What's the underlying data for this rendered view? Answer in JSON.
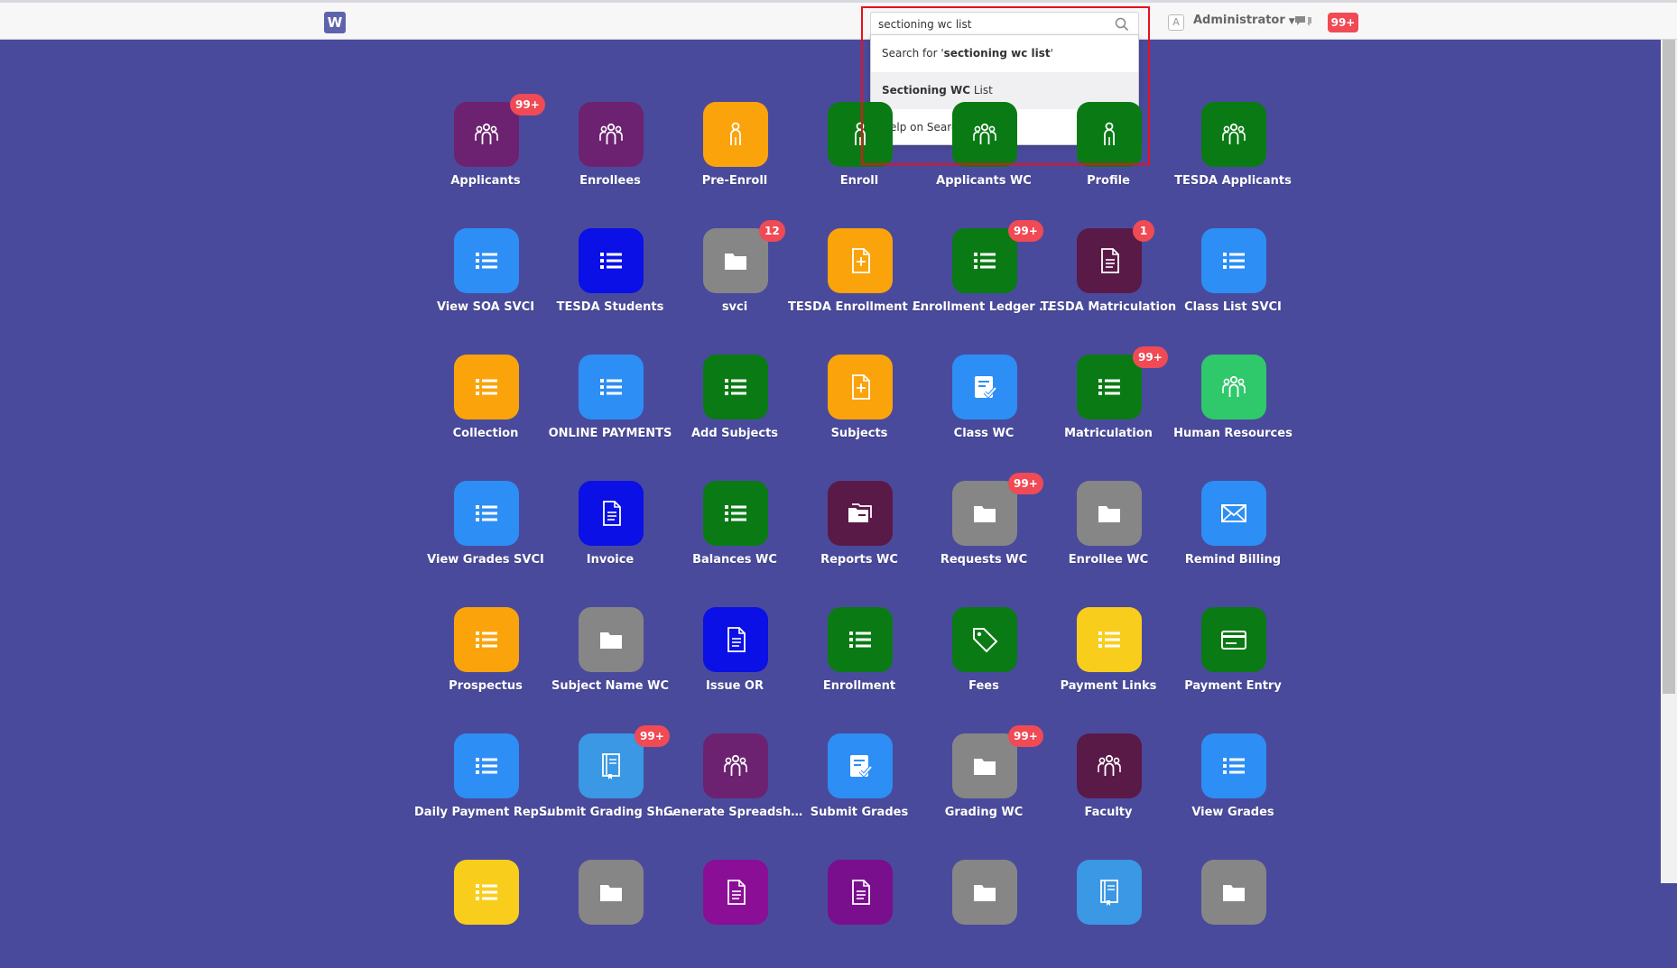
{
  "header": {
    "logo_text": "W",
    "search": {
      "value": "sectioning wc list"
    },
    "user_initial": "A",
    "user_name": "Administrator",
    "notification_count": "99+"
  },
  "dropdown": {
    "items": [
      {
        "prefix": "Search for '",
        "bold": "sectioning wc list",
        "suffix": "'"
      },
      {
        "prefix": "",
        "bold": "Sectioning WC",
        "suffix": " List"
      },
      {
        "prefix": "Help on Search",
        "bold": "",
        "suffix": ""
      }
    ]
  },
  "colors": {
    "background": "#4a4a9c",
    "highlight": "#e8101c",
    "badge": "#f04a55"
  },
  "tiles": [
    {
      "label": "Applicants",
      "color": "#6c2270",
      "icon": "group-icon",
      "badge": "99+"
    },
    {
      "label": "Enrollees",
      "color": "#6c2270",
      "icon": "group-icon",
      "badge": ""
    },
    {
      "label": "Pre-Enroll",
      "color": "#fba30b",
      "icon": "person-icon",
      "badge": ""
    },
    {
      "label": "Enroll",
      "color": "#0a7a14",
      "icon": "person-icon",
      "badge": ""
    },
    {
      "label": "Applicants WC",
      "color": "#0a7a14",
      "icon": "group-icon",
      "badge": ""
    },
    {
      "label": "Profile",
      "color": "#0a7a14",
      "icon": "person-icon",
      "badge": ""
    },
    {
      "label": "TESDA Applicants",
      "color": "#0a7a14",
      "icon": "group-icon",
      "badge": ""
    },
    {
      "label": "View SOA SVCI",
      "color": "#2d8ef5",
      "icon": "list-icon",
      "badge": ""
    },
    {
      "label": "TESDA Students",
      "color": "#0a10e6",
      "icon": "list-icon",
      "badge": ""
    },
    {
      "label": "svci",
      "color": "#868686",
      "icon": "folder-icon",
      "badge": "12"
    },
    {
      "label": "TESDA Enrollment Le...",
      "color": "#fba30b",
      "icon": "file-add-icon",
      "badge": ""
    },
    {
      "label": "Enrollment Ledger WC",
      "color": "#0a7a14",
      "icon": "list-icon",
      "badge": "99+"
    },
    {
      "label": "TESDA Matriculation",
      "color": "#5a1a47",
      "icon": "document-icon",
      "badge": "1"
    },
    {
      "label": "Class List SVCI",
      "color": "#2d8ef5",
      "icon": "list-icon",
      "badge": ""
    },
    {
      "label": "Collection",
      "color": "#fba30b",
      "icon": "list-icon",
      "badge": ""
    },
    {
      "label": "ONLINE PAYMENTS",
      "color": "#2d8ef5",
      "icon": "list-icon",
      "badge": ""
    },
    {
      "label": "Add Subjects",
      "color": "#0a7a14",
      "icon": "list-icon",
      "badge": ""
    },
    {
      "label": "Subjects",
      "color": "#fba30b",
      "icon": "file-add-icon",
      "badge": ""
    },
    {
      "label": "Class WC",
      "color": "#2d8ef5",
      "icon": "checklist-icon",
      "badge": ""
    },
    {
      "label": "Matriculation",
      "color": "#0a7a14",
      "icon": "list-icon",
      "badge": "99+"
    },
    {
      "label": "Human Resources",
      "color": "#2fc86a",
      "icon": "group-icon",
      "badge": ""
    },
    {
      "label": "View Grades SVCI",
      "color": "#2d8ef5",
      "icon": "list-icon",
      "badge": ""
    },
    {
      "label": "Invoice",
      "color": "#0a10e6",
      "icon": "document-icon",
      "badge": ""
    },
    {
      "label": "Balances WC",
      "color": "#0a7a14",
      "icon": "list-icon",
      "badge": ""
    },
    {
      "label": "Reports WC",
      "color": "#5a1a47",
      "icon": "folders-icon",
      "badge": ""
    },
    {
      "label": "Requests WC",
      "color": "#868686",
      "icon": "folder-icon",
      "badge": "99+"
    },
    {
      "label": "Enrollee WC",
      "color": "#868686",
      "icon": "folder-icon",
      "badge": ""
    },
    {
      "label": "Remind Billing",
      "color": "#2d8ef5",
      "icon": "envelope-icon",
      "badge": ""
    },
    {
      "label": "Prospectus",
      "color": "#fba30b",
      "icon": "list-icon",
      "badge": ""
    },
    {
      "label": "Subject Name WC",
      "color": "#868686",
      "icon": "folder-icon",
      "badge": ""
    },
    {
      "label": "Issue OR",
      "color": "#0a10e6",
      "icon": "document-icon",
      "badge": ""
    },
    {
      "label": "Enrollment",
      "color": "#0a7a14",
      "icon": "list-icon",
      "badge": ""
    },
    {
      "label": "Fees",
      "color": "#0a7a14",
      "icon": "tag-icon",
      "badge": ""
    },
    {
      "label": "Payment Links",
      "color": "#f9cd1b",
      "icon": "list-icon",
      "badge": ""
    },
    {
      "label": "Payment Entry",
      "color": "#0a7a14",
      "icon": "card-icon",
      "badge": ""
    },
    {
      "label": "Daily Payment Repor...",
      "color": "#2d8ef5",
      "icon": "list-icon",
      "badge": ""
    },
    {
      "label": "Submit Grading Sheet",
      "color": "#3a98e4",
      "icon": "book-icon",
      "badge": "99+"
    },
    {
      "label": "Generate Spreadsheets",
      "color": "#6c2270",
      "icon": "group-icon",
      "badge": ""
    },
    {
      "label": "Submit Grades",
      "color": "#2d8ef5",
      "icon": "checklist-icon",
      "badge": ""
    },
    {
      "label": "Grading WC",
      "color": "#868686",
      "icon": "folder-icon",
      "badge": "99+"
    },
    {
      "label": "Faculty",
      "color": "#5a1a47",
      "icon": "group-icon",
      "badge": ""
    },
    {
      "label": "View Grades",
      "color": "#2d8ef5",
      "icon": "list-icon",
      "badge": ""
    },
    {
      "label": "",
      "color": "#f9cd1b",
      "icon": "list-icon",
      "badge": ""
    },
    {
      "label": "",
      "color": "#868686",
      "icon": "folder-icon",
      "badge": ""
    },
    {
      "label": "",
      "color": "#8a0e96",
      "icon": "document-icon",
      "badge": ""
    },
    {
      "label": "",
      "color": "#7a0f8e",
      "icon": "document-icon",
      "badge": ""
    },
    {
      "label": "",
      "color": "#868686",
      "icon": "folder-icon",
      "badge": ""
    },
    {
      "label": "",
      "color": "#3a98e4",
      "icon": "book-icon",
      "badge": ""
    },
    {
      "label": "",
      "color": "#868686",
      "icon": "folder-icon",
      "badge": ""
    }
  ]
}
